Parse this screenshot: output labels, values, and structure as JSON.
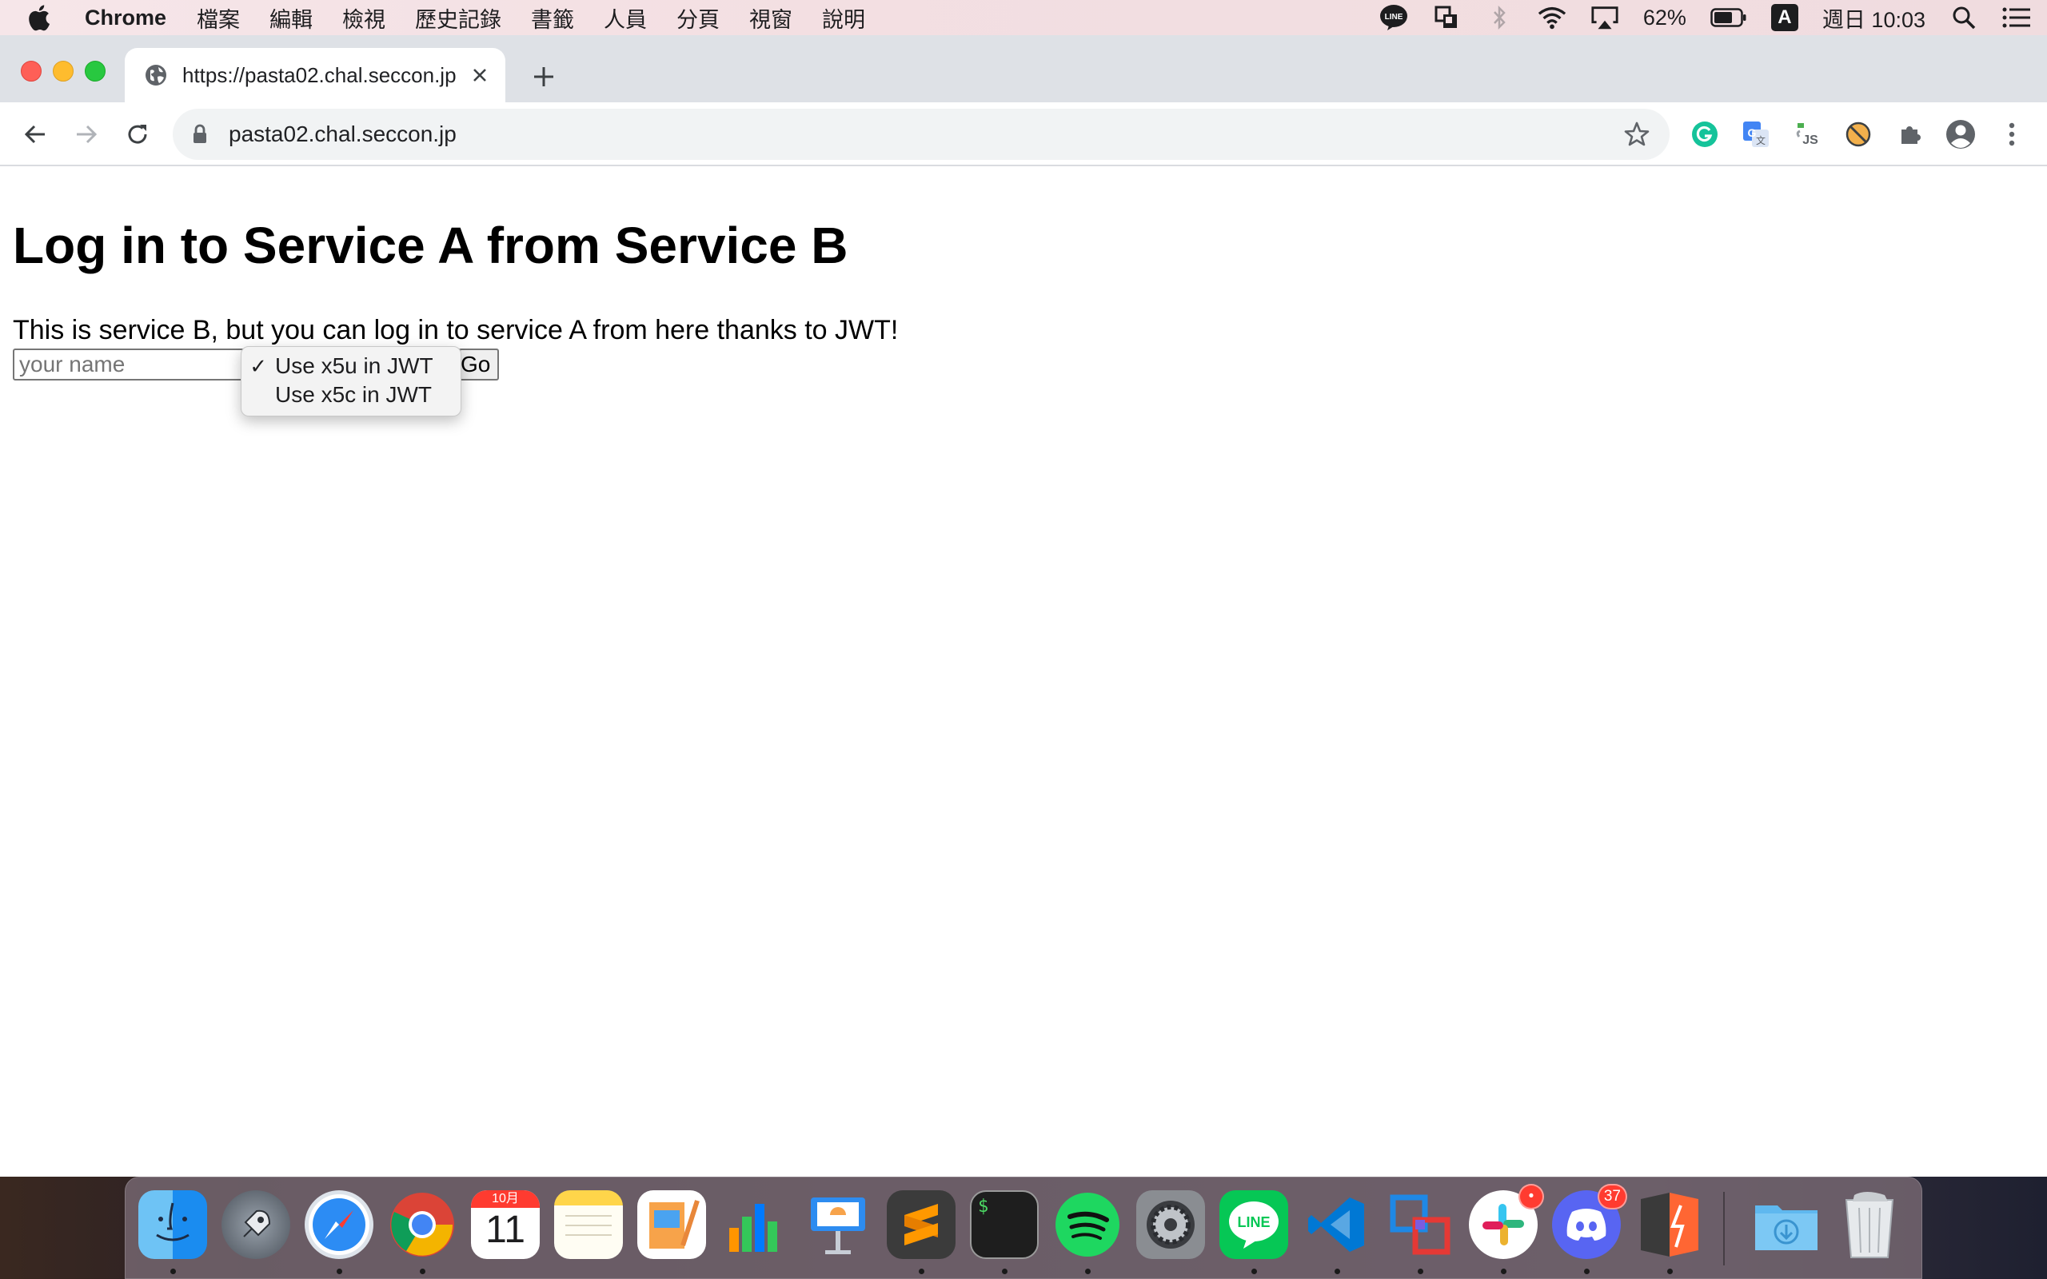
{
  "menubar": {
    "app_name": "Chrome",
    "items": [
      "檔案",
      "編輯",
      "檢視",
      "歷史記錄",
      "書籤",
      "人員",
      "分頁",
      "視窗",
      "說明"
    ],
    "battery": "62%",
    "input_method": "A",
    "clock": "週日 10:03",
    "status_icons": [
      "line-icon",
      "sync-icon",
      "bluetooth-icon",
      "wifi-icon",
      "airplay-icon",
      "battery-icon",
      "spotlight-icon",
      "control-center-icon"
    ]
  },
  "browser": {
    "tab_title": "https://pasta02.chal.seccon.jp",
    "url": "pasta02.chal.seccon.jp",
    "extensions": [
      "grammarly-icon",
      "google-translate-icon",
      "javascript-toggle-icon",
      "extension-blocked-icon",
      "extensions-puzzle-icon",
      "profile-avatar-icon",
      "kebab-menu-icon"
    ]
  },
  "page": {
    "heading": "Log in to Service A from Service B",
    "intro": "This is service B, but you can log in to service A from here thanks to JWT!",
    "name_placeholder": "your name",
    "go_label": "Go",
    "select": {
      "options": [
        "Use x5u in JWT",
        "Use x5c in JWT"
      ],
      "selected_index": 0,
      "check_mark": "✓"
    }
  },
  "dock": {
    "apps": [
      "finder-icon",
      "launchpad-icon",
      "safari-icon",
      "chrome-icon",
      "calendar-icon",
      "notes-icon",
      "pages-icon",
      "numbers-icon",
      "keynote-icon",
      "sublime-text-icon",
      "terminal-icon",
      "spotify-icon",
      "system-preferences-icon",
      "line-icon",
      "vscode-icon",
      "vmware-fusion-icon",
      "slack-icon",
      "discord-icon",
      "burp-suite-icon",
      "downloads-folder-icon",
      "trash-icon"
    ],
    "calendar_month": "10月",
    "calendar_day": "11",
    "slack_badge": "•",
    "discord_badge": "37",
    "terminal_prompt": "$",
    "line_label": "LINE"
  },
  "colors": {
    "accent_blue": "#1a73e8",
    "traffic_red": "#fe5f57",
    "traffic_yellow": "#febc2e",
    "traffic_green": "#28c840"
  }
}
